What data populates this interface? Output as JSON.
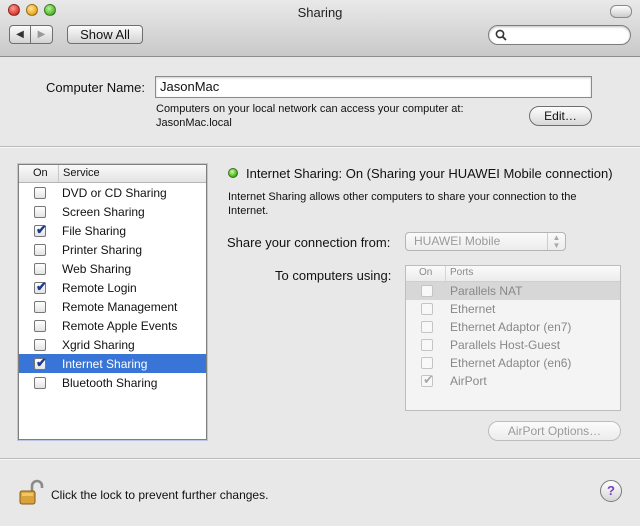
{
  "window": {
    "title": "Sharing"
  },
  "toolbar": {
    "show_all_label": "Show All"
  },
  "computer_name": {
    "label": "Computer Name:",
    "value": "JasonMac",
    "description_line1": "Computers on your local network can access your computer at:",
    "description_line2": "JasonMac.local",
    "edit_label": "Edit…"
  },
  "services": {
    "header_on": "On",
    "header_service": "Service",
    "items": [
      {
        "label": "DVD or CD Sharing",
        "checked": false
      },
      {
        "label": "Screen Sharing",
        "checked": false
      },
      {
        "label": "File Sharing",
        "checked": true
      },
      {
        "label": "Printer Sharing",
        "checked": false
      },
      {
        "label": "Web Sharing",
        "checked": false
      },
      {
        "label": "Remote Login",
        "checked": true
      },
      {
        "label": "Remote Management",
        "checked": false
      },
      {
        "label": "Remote Apple Events",
        "checked": false
      },
      {
        "label": "Xgrid Sharing",
        "checked": false
      },
      {
        "label": "Internet Sharing",
        "checked": true,
        "selected": true
      },
      {
        "label": "Bluetooth Sharing",
        "checked": false
      }
    ]
  },
  "detail": {
    "status": "Internet Sharing: On (Sharing your HUAWEI Mobile connection)",
    "description_line1": "Internet Sharing allows other computers to share your connection to the",
    "description_line2": "Internet.",
    "share_from_label": "Share your connection from:",
    "share_from_value": "HUAWEI Mobile",
    "to_computers_label": "To computers using:",
    "ports_header_on": "On",
    "ports_header_ports": "Ports",
    "ports": [
      {
        "label": "Parallels NAT",
        "checked": false
      },
      {
        "label": "Ethernet",
        "checked": false
      },
      {
        "label": "Ethernet Adaptor (en7)",
        "checked": false
      },
      {
        "label": "Parallels Host-Guest",
        "checked": false
      },
      {
        "label": "Ethernet Adaptor (en6)",
        "checked": false
      },
      {
        "label": "AirPort",
        "checked": true
      }
    ],
    "airport_options_label": "AirPort Options…"
  },
  "footer": {
    "lock_text": "Click the lock to prevent further changes.",
    "help_label": "?"
  },
  "colors": {
    "selection": "#3875d7",
    "status_on": "#3fb012"
  }
}
